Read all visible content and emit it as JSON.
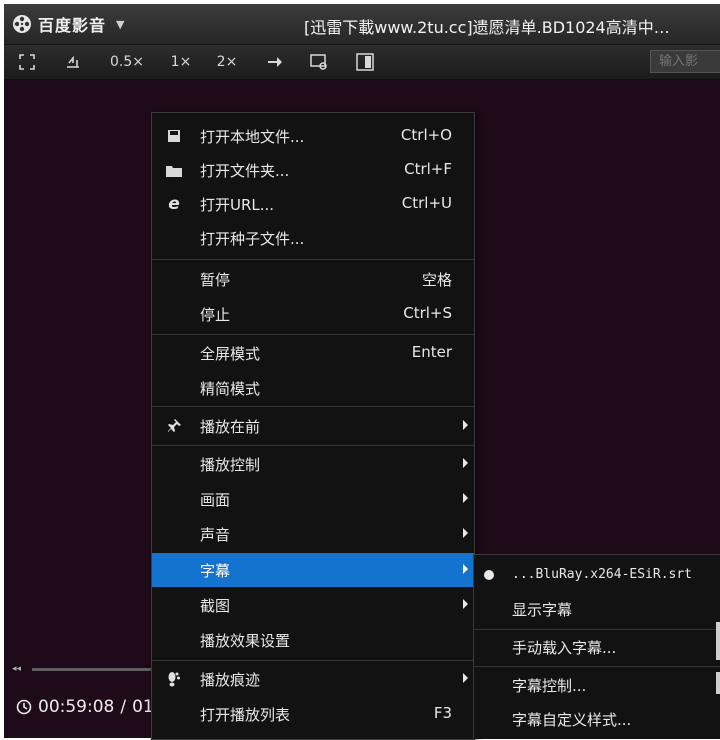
{
  "titlebar": {
    "app_name": "百度影音",
    "menu_arrow": "▼",
    "file_title": "[迅雷下載www.2tu.cc]遗愿清单.BD1024高清中…"
  },
  "toolbar": {
    "speed_half": "0.5×",
    "speed_1x": "1×",
    "speed_2x": "2×",
    "search_placeholder": "输入影"
  },
  "playback": {
    "current_time": "00:59:08",
    "separator": "/",
    "total_time_partial": "01"
  },
  "context_menu": {
    "items": [
      {
        "label": "打开本地文件...",
        "shortcut": "Ctrl+O",
        "icon": "folder-disk-icon"
      },
      {
        "label": "打开文件夹...",
        "shortcut": "Ctrl+F",
        "icon": "folder-icon"
      },
      {
        "label": "打开URL...",
        "shortcut": "Ctrl+U",
        "icon": "ie-icon"
      },
      {
        "label": "打开种子文件...",
        "shortcut": ""
      },
      {
        "label": "暂停",
        "shortcut": "空格"
      },
      {
        "label": "停止",
        "shortcut": "Ctrl+S"
      },
      {
        "label": "全屏模式",
        "shortcut": "Enter"
      },
      {
        "label": "精简模式",
        "shortcut": ""
      },
      {
        "label": "播放在前",
        "shortcut": "",
        "icon": "pin-icon",
        "submenu": true
      },
      {
        "label": "播放控制",
        "shortcut": "",
        "submenu": true
      },
      {
        "label": "画面",
        "shortcut": "",
        "submenu": true
      },
      {
        "label": "声音",
        "shortcut": "",
        "submenu": true
      },
      {
        "label": "字幕",
        "shortcut": "",
        "submenu": true,
        "highlighted": true
      },
      {
        "label": "截图",
        "shortcut": "",
        "submenu": true
      },
      {
        "label": "播放效果设置",
        "shortcut": ""
      },
      {
        "label": "播放痕迹",
        "shortcut": "",
        "icon": "footprint-icon",
        "submenu": true
      },
      {
        "label": "打开播放列表",
        "shortcut": "F3"
      }
    ]
  },
  "subtitle_menu": {
    "items": [
      {
        "label": "...BluRay.x264-ESiR.srt",
        "selected": true
      },
      {
        "label": "显示字幕"
      },
      {
        "label": "手动载入字幕..."
      },
      {
        "label": "字幕控制..."
      },
      {
        "label": "字幕自定义样式..."
      }
    ]
  },
  "colors": {
    "highlight": "#1573d0",
    "video_bg": "#1e0a18",
    "menu_bg": "#121212"
  }
}
